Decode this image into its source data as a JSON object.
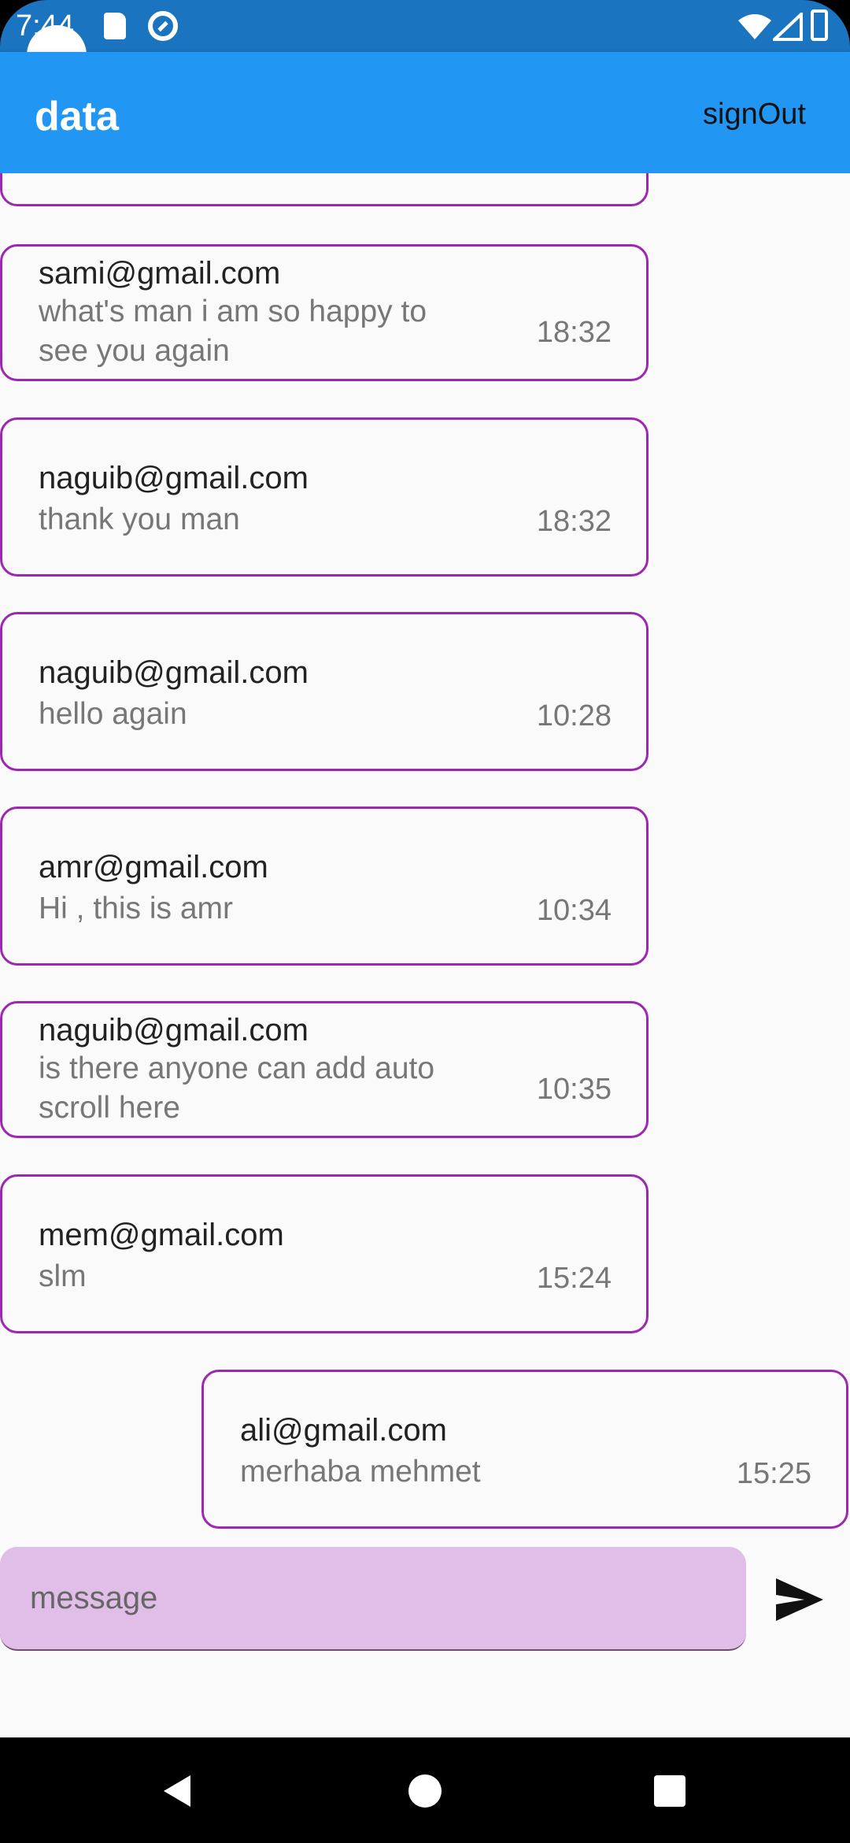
{
  "status_bar": {
    "time": "7:44",
    "icons": [
      "sd-card-icon",
      "do-not-disturb-icon",
      "wifi-icon",
      "signal-icon",
      "battery-icon"
    ]
  },
  "app_bar": {
    "title": "data",
    "sign_out_label": "signOut",
    "color": "#2196f3"
  },
  "messages": [
    {
      "sender": "sami@gmail.com",
      "text": "what's man i am so happy to see you again",
      "time": "18:32"
    },
    {
      "sender": "naguib@gmail.com",
      "text": "thank you man",
      "time": "18:32"
    },
    {
      "sender": "naguib@gmail.com",
      "text": "hello again",
      "time": "10:28"
    },
    {
      "sender": "amr@gmail.com",
      "text": "Hi , this is amr",
      "time": "10:34"
    },
    {
      "sender": "naguib@gmail.com",
      "text": "is there anyone can add auto scroll here",
      "time": "10:35"
    },
    {
      "sender": "mem@gmail.com",
      "text": "slm",
      "time": "15:24"
    },
    {
      "sender": "ali@gmail.com",
      "text": "merhaba mehmet",
      "time": "15:25"
    }
  ],
  "composer": {
    "placeholder": "message",
    "value": "",
    "send_icon": "send-icon"
  },
  "colors": {
    "bubble_border": "#9c27b0",
    "input_background": "#e1bee7"
  }
}
